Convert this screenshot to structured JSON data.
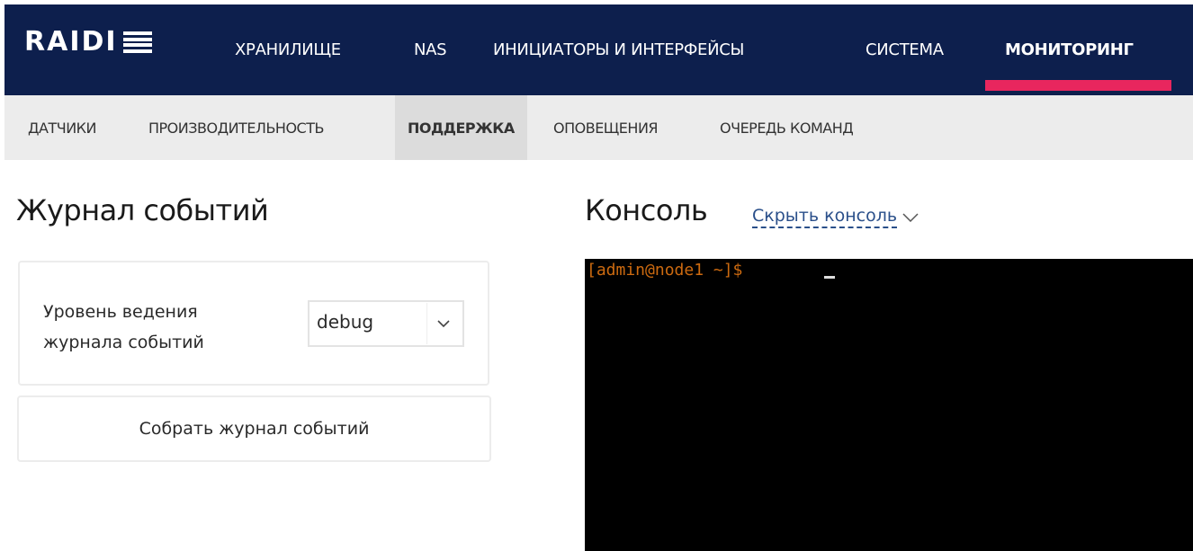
{
  "header": {
    "logo": "RAIDI",
    "nav": [
      {
        "label": "ХРАНИЛИЩЕ"
      },
      {
        "label": "NAS"
      },
      {
        "label": "ИНИЦИАТОРЫ И ИНТЕРФЕЙСЫ"
      },
      {
        "label": "СИСТЕМА"
      },
      {
        "label": "МОНИТОРИНГ",
        "active": true
      }
    ],
    "accent_color": "#e8265e",
    "background_color": "#0d1f4d"
  },
  "subnav": [
    {
      "label": "ДАТЧИКИ"
    },
    {
      "label": "ПРОИЗВОДИТЕЛЬНОСТЬ"
    },
    {
      "label": "ПОДДЕРЖКА",
      "active": true
    },
    {
      "label": "ОПОВЕЩЕНИЯ"
    },
    {
      "label": "ОЧЕРЕДЬ КОМАНД"
    }
  ],
  "event_log": {
    "title": "Журнал событий",
    "level_label": "Уровень ведения журнала событий",
    "level_value": "debug",
    "collect_button": "Собрать журнал событий"
  },
  "console": {
    "title": "Консоль",
    "hide_link": "Скрыть консоль",
    "hide_icon": "chevron-down-icon",
    "prompt": "[admin@node1 ~]$",
    "prompt_color": "#cc6a10"
  }
}
